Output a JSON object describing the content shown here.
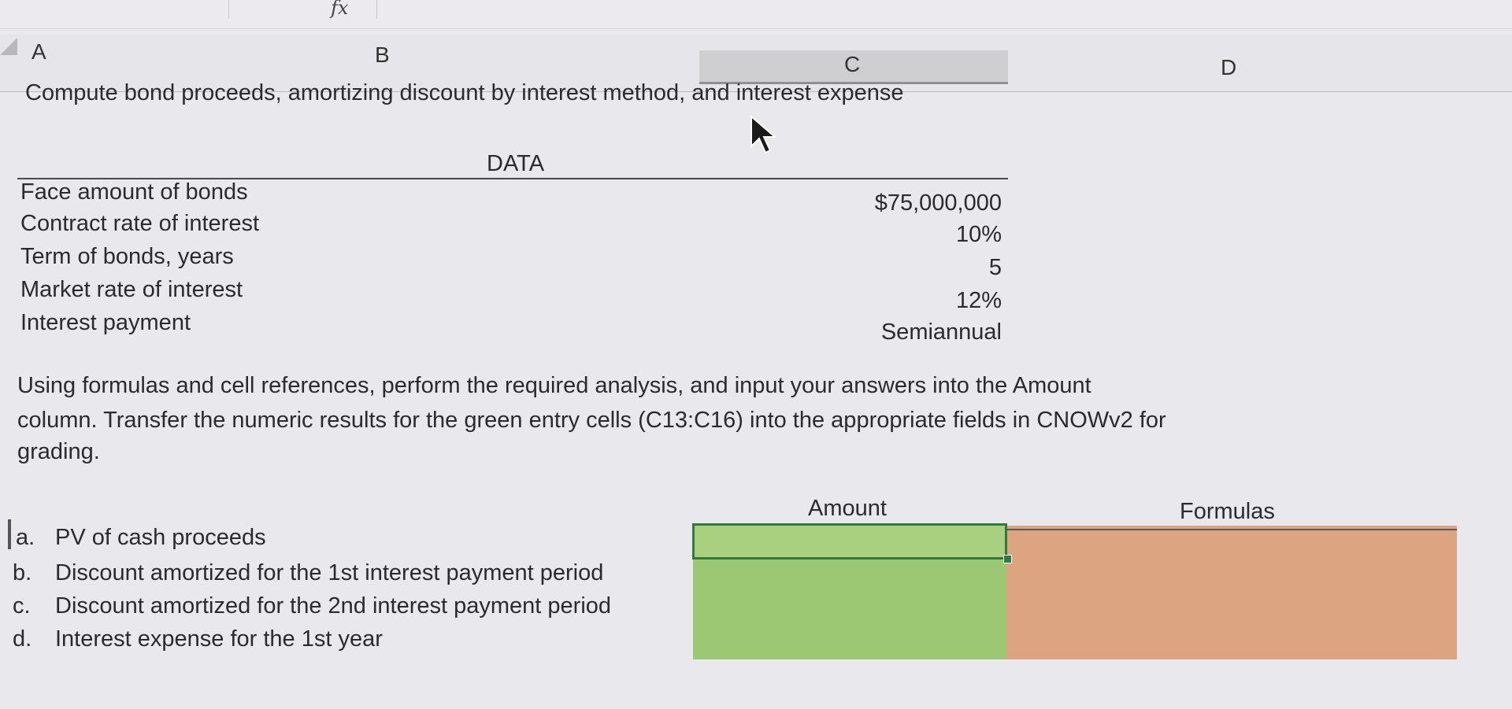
{
  "formula_bar": {
    "fx_symbol": "fx"
  },
  "column_headers": [
    "A",
    "B",
    "C",
    "D"
  ],
  "title": "Compute bond proceeds, amortizing discount by interest method, and interest expense",
  "data_section": {
    "header": "DATA",
    "rows": [
      {
        "label": "Face amount of bonds",
        "value": "$75,000,000"
      },
      {
        "label": "Contract rate of interest",
        "value": "10%"
      },
      {
        "label": "Term of bonds, years",
        "value": "5"
      },
      {
        "label": "Market rate of interest",
        "value": "12%"
      },
      {
        "label": "Interest payment",
        "value": "Semiannual"
      }
    ]
  },
  "instructions": {
    "line1": "Using formulas and cell references, perform the required analysis, and input your answers into the Amount",
    "line2": "column. Transfer the numeric results for the green entry cells (C13:C16) into the appropriate fields in CNOWv2 for",
    "line3": "grading."
  },
  "answers": {
    "amount_header": "Amount",
    "formulas_header": "Formulas",
    "items": [
      {
        "letter": "a.",
        "label": "PV of cash proceeds",
        "amount": "",
        "formula": ""
      },
      {
        "letter": "b.",
        "label": "Discount amortized for the 1st interest payment period",
        "amount": "",
        "formula": ""
      },
      {
        "letter": "c.",
        "label": "Discount amortized for the 2nd interest payment period",
        "amount": "",
        "formula": ""
      },
      {
        "letter": "d.",
        "label": "Interest expense for the 1st year",
        "amount": "",
        "formula": ""
      }
    ]
  },
  "colors": {
    "amount_cell": "#9cc873",
    "formula_cell": "#dca481",
    "selection_border": "#2f7a3c"
  }
}
